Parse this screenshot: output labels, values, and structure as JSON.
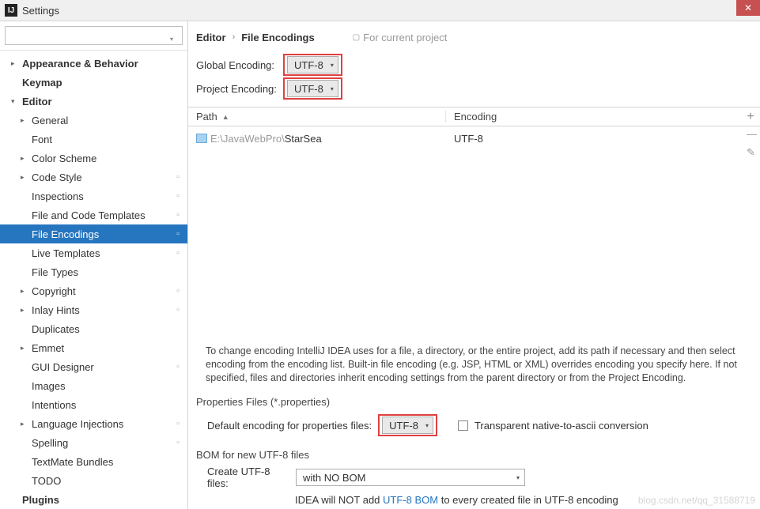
{
  "titlebar": {
    "title": "Settings",
    "icon_letter": "IJ"
  },
  "search": {
    "placeholder": ""
  },
  "sidebar": {
    "items": [
      {
        "label": "Appearance & Behavior",
        "level": 0,
        "expand": "closed",
        "bold": true
      },
      {
        "label": "Keymap",
        "level": 0,
        "expand": "none",
        "bold": true
      },
      {
        "label": "Editor",
        "level": 0,
        "expand": "open",
        "bold": true
      },
      {
        "label": "General",
        "level": 1,
        "expand": "closed"
      },
      {
        "label": "Font",
        "level": 1,
        "expand": "none"
      },
      {
        "label": "Color Scheme",
        "level": 1,
        "expand": "closed"
      },
      {
        "label": "Code Style",
        "level": 1,
        "expand": "closed",
        "mark": true
      },
      {
        "label": "Inspections",
        "level": 1,
        "expand": "none",
        "mark": true
      },
      {
        "label": "File and Code Templates",
        "level": 1,
        "expand": "none",
        "mark": true
      },
      {
        "label": "File Encodings",
        "level": 1,
        "expand": "none",
        "mark": true,
        "selected": true
      },
      {
        "label": "Live Templates",
        "level": 1,
        "expand": "none",
        "mark": true
      },
      {
        "label": "File Types",
        "level": 1,
        "expand": "none"
      },
      {
        "label": "Copyright",
        "level": 1,
        "expand": "closed",
        "mark": true
      },
      {
        "label": "Inlay Hints",
        "level": 1,
        "expand": "closed",
        "mark": true
      },
      {
        "label": "Duplicates",
        "level": 1,
        "expand": "none"
      },
      {
        "label": "Emmet",
        "level": 1,
        "expand": "closed"
      },
      {
        "label": "GUI Designer",
        "level": 1,
        "expand": "none",
        "mark": true
      },
      {
        "label": "Images",
        "level": 1,
        "expand": "none"
      },
      {
        "label": "Intentions",
        "level": 1,
        "expand": "none"
      },
      {
        "label": "Language Injections",
        "level": 1,
        "expand": "closed",
        "mark": true
      },
      {
        "label": "Spelling",
        "level": 1,
        "expand": "none",
        "mark": true
      },
      {
        "label": "TextMate Bundles",
        "level": 1,
        "expand": "none"
      },
      {
        "label": "TODO",
        "level": 1,
        "expand": "none"
      },
      {
        "label": "Plugins",
        "level": 0,
        "expand": "none",
        "bold": true
      }
    ]
  },
  "breadcrumb": {
    "bc1": "Editor",
    "bc2": "File Encodings",
    "hint": "For current project"
  },
  "enc": {
    "global_label": "Global Encoding:",
    "global_value": "UTF-8",
    "project_label": "Project Encoding:",
    "project_value": "UTF-8"
  },
  "table": {
    "col1": "Path",
    "col2": "Encoding",
    "row": {
      "path_prefix": "E:\\JavaWebPro\\",
      "path_name": "StarSea",
      "encoding": "UTF-8"
    }
  },
  "info": "To change encoding IntelliJ IDEA uses for a file, a directory, or the entire project, add its path if necessary and then select encoding from the encoding list. Built-in file encoding (e.g. JSP, HTML or XML) overrides encoding you specify here. If not specified, files and directories inherit encoding settings from the parent directory or from the Project Encoding.",
  "props": {
    "section": "Properties Files (*.properties)",
    "label": "Default encoding for properties files:",
    "value": "UTF-8",
    "chk_label": "Transparent native-to-ascii conversion"
  },
  "bom": {
    "section": "BOM for new UTF-8 files",
    "label": "Create UTF-8 files:",
    "value": "with NO BOM",
    "info_pre": "IDEA will NOT add ",
    "info_link": "UTF-8 BOM",
    "info_post": " to every created file in UTF-8 encoding"
  },
  "watermark": "blog.csdn.net/qq_31588719"
}
